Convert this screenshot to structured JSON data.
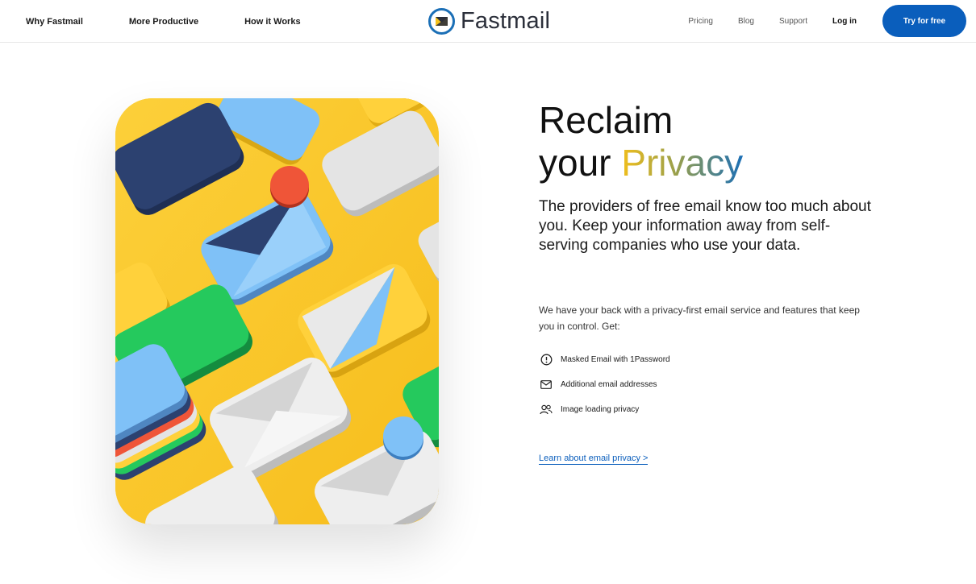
{
  "header": {
    "nav_left": [
      "Why Fastmail",
      "More Productive",
      "How it Works"
    ],
    "brand": "Fastmail",
    "nav_right": [
      "Pricing",
      "Blog",
      "Support",
      "Log in"
    ],
    "cta_label": "Try for free"
  },
  "hero": {
    "headline_line1": "Reclaim",
    "headline_line2_prefix": "your ",
    "headline_line2_highlight": "Privacy",
    "lead": "The providers of free email know too much about you. Keep your information away from self-serving companies who use your data.",
    "body": "We have your back with a privacy-first email service and features that keep you in control. Get:",
    "features": [
      {
        "icon": "info-circle-icon",
        "label": "Masked Email with 1Password"
      },
      {
        "icon": "envelope-icon",
        "label": "Additional email addresses"
      },
      {
        "icon": "users-icon",
        "label": "Image loading privacy"
      }
    ],
    "link_label": "Learn about email privacy >"
  },
  "colors": {
    "accent": "#0a5ebc",
    "illustration_bg": "#fcc72a"
  }
}
